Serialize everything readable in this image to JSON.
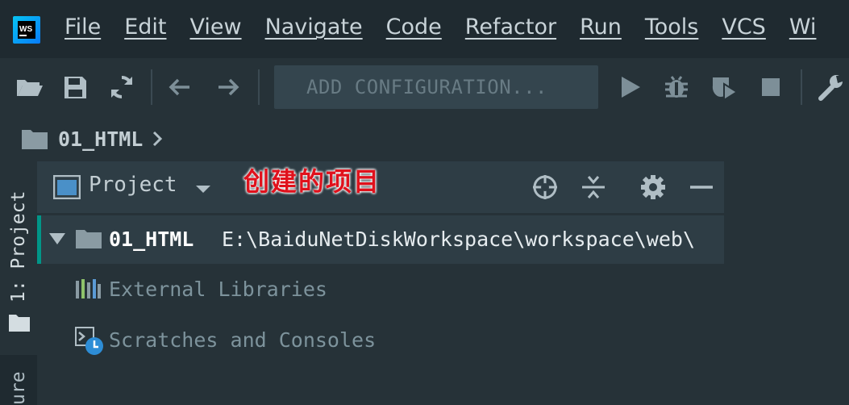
{
  "app": {
    "logo_text": "WS"
  },
  "menu": {
    "items": [
      "File",
      "Edit",
      "View",
      "Navigate",
      "Code",
      "Refactor",
      "Run",
      "Tools",
      "VCS",
      "Wi"
    ]
  },
  "toolbar": {
    "config_label": "ADD CONFIGURATION...",
    "icons": [
      "open-folder-icon",
      "save-icon",
      "sync-icon",
      "back-arrow-icon",
      "forward-arrow-icon",
      "run-icon",
      "debug-icon",
      "coverage-icon",
      "stop-icon",
      "wrench-icon"
    ]
  },
  "breadcrumb": {
    "label": "01_HTML"
  },
  "side_strip": {
    "project_label": "1: Project",
    "structure_label": "ure"
  },
  "panel": {
    "title": "Project",
    "annotation": "创建的项目",
    "tree": [
      {
        "name": "01_HTML",
        "path": "E:\\BaiduNetDiskWorkspace\\workspace\\web\\"
      },
      {
        "name": "External Libraries"
      },
      {
        "name": "Scratches and Consoles"
      }
    ]
  },
  "colors": {
    "background": "#263238",
    "menubar": "#1f2a30",
    "accent": "#009688",
    "annotation": "#e0111c"
  }
}
